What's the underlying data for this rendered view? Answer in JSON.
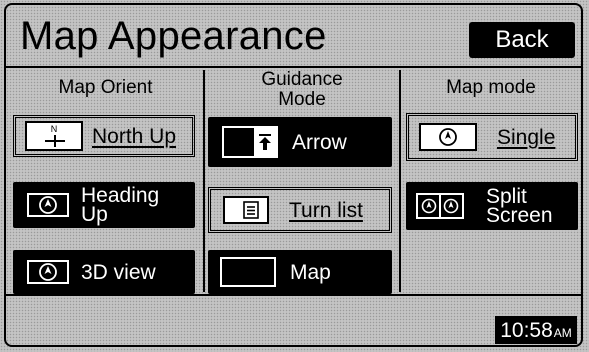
{
  "header": {
    "title": "Map Appearance",
    "back_label": "Back"
  },
  "columns": {
    "orient": {
      "title": "Map Orient",
      "north_up": "North Up",
      "north_letter": "N",
      "heading_up_1": "Heading",
      "heading_up_2": "Up",
      "view_3d": "3D view"
    },
    "guidance": {
      "title_1": "Guidance",
      "title_2": "Mode",
      "arrow": "Arrow",
      "turn_list": "Turn list",
      "map": "Map"
    },
    "mode": {
      "title": "Map mode",
      "single": "Single",
      "split_1": "Split",
      "split_2": "Screen"
    }
  },
  "status": {
    "time": "10:58",
    "ampm": "AM"
  },
  "icons": {
    "north_up": "north-arrow-icon",
    "heading_up": "heading-compass-icon",
    "view_3d": "heading-compass-icon",
    "arrow": "guidance-arrow-icon",
    "turn_list": "list-icon",
    "map": "blank-map-icon",
    "single": "single-map-icon",
    "split": "split-map-icon"
  },
  "colors": {
    "background": "#c4c4c4",
    "button_dark": "#000000",
    "text_light": "#ffffff"
  }
}
